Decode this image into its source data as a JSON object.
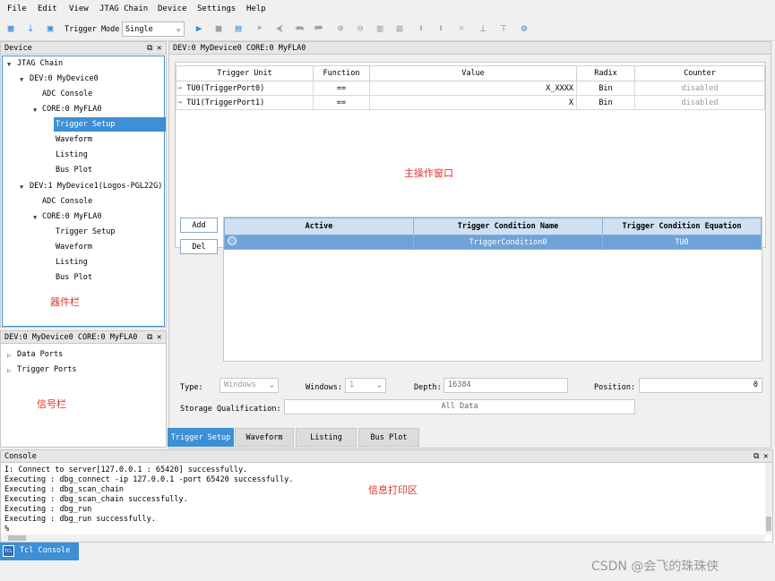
{
  "menu": [
    "File",
    "Edit",
    "View",
    "JTAG Chain",
    "Device",
    "Settings",
    "Help"
  ],
  "toolbar": {
    "trigger_mode_label": "Trigger Mode",
    "trigger_mode_value": "Single"
  },
  "device_panel": {
    "title": "Device",
    "items": [
      {
        "label": "JTAG Chain"
      },
      {
        "label": "DEV:0 MyDevice0"
      },
      {
        "label": "ADC Console"
      },
      {
        "label": "CORE:0 MyFLA0"
      },
      {
        "label": "Trigger Setup"
      },
      {
        "label": "Waveform"
      },
      {
        "label": "Listing"
      },
      {
        "label": "Bus Plot"
      },
      {
        "label": "DEV:1 MyDevice1(Logos-PGL22G)"
      },
      {
        "label": "ADC Console"
      },
      {
        "label": "CORE:0 MyFLA0"
      },
      {
        "label": "Trigger Setup"
      },
      {
        "label": "Waveform"
      },
      {
        "label": "Listing"
      },
      {
        "label": "Bus Plot"
      }
    ],
    "annotation": "器件栏"
  },
  "signal_panel": {
    "title": "DEV:0 MyDevice0 CORE:0 MyFLA0",
    "items": [
      "Data Ports",
      "Trigger Ports"
    ],
    "annotation": "信号栏"
  },
  "main": {
    "title": "DEV:0 MyDevice0 CORE:0 MyFLA0",
    "annotation": "主操作窗口",
    "trigger_table": {
      "headers": [
        "Trigger Unit",
        "Function",
        "Value",
        "Radix",
        "Counter"
      ],
      "rows": [
        [
          "TU0(TriggerPort0)",
          "==",
          "X_XXXX",
          "Bin",
          "disabled"
        ],
        [
          "TU1(TriggerPort1)",
          "==",
          "X",
          "Bin",
          "disabled"
        ]
      ]
    },
    "add_label": "Add",
    "del_label": "Del",
    "condition_table": {
      "headers": [
        "Active",
        "Trigger Condition Name",
        "Trigger Condition Equation"
      ],
      "rows": [
        [
          "",
          "TriggerCondition0",
          "TU0"
        ]
      ]
    },
    "type_label": "Type:",
    "type_value": "Windows",
    "windows_label": "Windows:",
    "windows_value": "1",
    "depth_label": "Depth:",
    "depth_value": "16384",
    "position_label": "Position:",
    "position_value": "0",
    "storage_label": "Storage Qualification:",
    "storage_value": "All Data",
    "tabs": [
      "Trigger Setup",
      "Waveform",
      "Listing",
      "Bus Plot"
    ]
  },
  "console": {
    "title": "Console",
    "annotation": "信息打印区",
    "lines": [
      "I: Connect to server[127.0.0.1 : 65420] successfully.",
      "Executing : dbg_connect -ip 127.0.0.1 -port 65420 successfully.",
      "Executing : dbg_scan_chain",
      "Executing : dbg_scan_chain successfully.",
      "Executing : dbg_run",
      "Executing : dbg_run successfully.",
      "%"
    ],
    "tcl_tab": "Tcl Console",
    "tcl_icon": "TCL"
  },
  "watermark": "CSDN @会飞的珠珠侠"
}
